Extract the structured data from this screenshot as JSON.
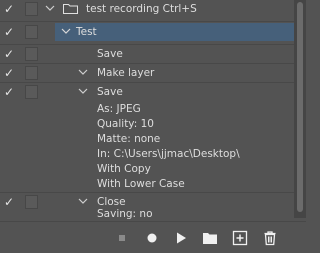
{
  "actions_panel": {
    "rows": [
      {
        "text": "test recording Ctrl+S",
        "checked": true
      },
      {
        "text": "Test",
        "checked": true
      },
      {
        "text": "Save",
        "checked": true
      },
      {
        "text": "Make layer",
        "checked": true
      },
      {
        "text": "Save",
        "checked": true
      },
      {
        "text": "As: JPEG"
      },
      {
        "text": "Quality: 10"
      },
      {
        "text": "Matte: none"
      },
      {
        "text": "In: C:\\Users\\jjmac\\Desktop\\"
      },
      {
        "text": "With Copy"
      },
      {
        "text": "With Lower Case"
      },
      {
        "text": "Close",
        "checked": true
      },
      {
        "text": "Saving: no"
      }
    ],
    "selected_row": "Test",
    "check_glyph": "✓"
  },
  "toolbar": {
    "icons": [
      "stop-icon",
      "record-icon",
      "play-icon",
      "folder-icon",
      "new-action-icon",
      "trash-icon"
    ]
  },
  "colors": {
    "panel_bg": "#535353",
    "selected_bg": "#46607a",
    "text": "#dedede"
  }
}
